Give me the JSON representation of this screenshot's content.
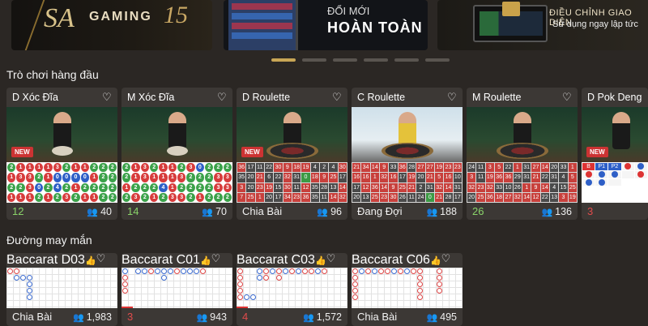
{
  "banners": [
    {
      "logo": "SA",
      "title": "GAMING",
      "badge": "15"
    },
    {
      "line1": "ĐỔI MỚI",
      "line2": "HOÀN TOÀN"
    },
    {
      "line1": "ĐIỀU CHỈNH GIAO DIỆN",
      "line2": "Sử dụng ngay lập tức"
    }
  ],
  "top_games": {
    "title": "Trò chơi hàng đầu",
    "cards": [
      {
        "name": "D Xóc Đĩa",
        "new": "NEW",
        "status": "12",
        "players": "40"
      },
      {
        "name": "M Xóc Đĩa",
        "status": "14",
        "players": "70"
      },
      {
        "name": "D Roulette",
        "new": "NEW",
        "status": "Chia Bài",
        "players": "96"
      },
      {
        "name": "C Roulette",
        "status": "Đang Đợi",
        "players": "188"
      },
      {
        "name": "M Roulette",
        "status": "26",
        "players": "136"
      },
      {
        "name": "D Pok Deng",
        "new": "NEW",
        "status": "3",
        "players": ""
      }
    ]
  },
  "lucky_road": {
    "title": "Đường may mắn",
    "cards": [
      {
        "name": "Baccarat D03",
        "status": "Chia Bài",
        "players": "1,983"
      },
      {
        "name": "Baccarat C01",
        "status": "3",
        "players": "943"
      },
      {
        "name": "Baccarat C03",
        "status": "4",
        "players": "1,572"
      },
      {
        "name": "Baccarat C06",
        "status": "Chia Bài",
        "players": "495"
      }
    ]
  },
  "pokdeng": {
    "headers": [
      "B",
      "P1",
      "P2"
    ]
  },
  "boards": {
    "xocdia1": [
      "2",
      "1",
      "1",
      "1",
      "1",
      "3",
      "2",
      "1",
      "1",
      "2",
      "2",
      "2",
      "1",
      "3",
      "3",
      "2",
      "1",
      "0",
      "0",
      "0",
      "0",
      "1",
      "2",
      "2",
      "2",
      "2",
      "3",
      "0",
      "2",
      "4",
      "2",
      "1",
      "2",
      "2",
      "2",
      "2",
      "1",
      "1",
      "1",
      "2",
      "1",
      "2",
      "3",
      "2",
      "1",
      "1",
      "2",
      "2"
    ],
    "xocdia2": [
      "2",
      "1",
      "3",
      "2",
      "1",
      "1",
      "2",
      "3",
      "0",
      "2",
      "2",
      "2",
      "2",
      "1",
      "3",
      "1",
      "1",
      "1",
      "3",
      "2",
      "2",
      "2",
      "3",
      "3",
      "1",
      "2",
      "2",
      "2",
      "4",
      "1",
      "2",
      "2",
      "2",
      "2",
      "3",
      "3",
      "2",
      "3",
      "2",
      "1",
      "2",
      "3",
      "3",
      "2",
      "1",
      "2",
      "2",
      "2"
    ],
    "roulette1": [
      "36",
      "17",
      "11",
      "22",
      "30",
      "9",
      "18",
      "19",
      "4",
      "2",
      "4",
      "30",
      "35",
      "20",
      "21",
      "6",
      "22",
      "32",
      "31",
      "0",
      "18",
      "9",
      "25",
      "17",
      "3",
      "20",
      "23",
      "19",
      "15",
      "30",
      "11",
      "12",
      "35",
      "28",
      "13",
      "14",
      "7",
      "25",
      "1",
      "20",
      "17",
      "34",
      "23",
      "36",
      "35",
      "11",
      "14",
      "32"
    ],
    "roulette2": [
      "21",
      "34",
      "14",
      "9",
      "33",
      "36",
      "28",
      "27",
      "27",
      "19",
      "23",
      "23",
      "16",
      "16",
      "1",
      "32",
      "16",
      "17",
      "19",
      "20",
      "21",
      "5",
      "16",
      "10",
      "17",
      "12",
      "36",
      "14",
      "9",
      "25",
      "21",
      "2",
      "31",
      "32",
      "14",
      "31",
      "20",
      "13",
      "25",
      "23",
      "30",
      "26",
      "11",
      "24",
      "0",
      "21",
      "28",
      "17"
    ],
    "roulette3": [
      "24",
      "11",
      "3",
      "5",
      "22",
      "1",
      "31",
      "27",
      "14",
      "20",
      "33",
      "1",
      "3",
      "11",
      "19",
      "36",
      "36",
      "29",
      "31",
      "21",
      "22",
      "31",
      "4",
      "5",
      "32",
      "23",
      "32",
      "33",
      "10",
      "26",
      "1",
      "9",
      "14",
      "4",
      "15",
      "25",
      "20",
      "25",
      "36",
      "18",
      "27",
      "32",
      "14",
      "12",
      "22",
      "13",
      "3",
      "19"
    ]
  },
  "colors": {
    "accent": "#c8a656",
    "background": "#2b2724",
    "card": "#3c3835",
    "green": "#8ad36a",
    "red": "#e04b4b"
  }
}
